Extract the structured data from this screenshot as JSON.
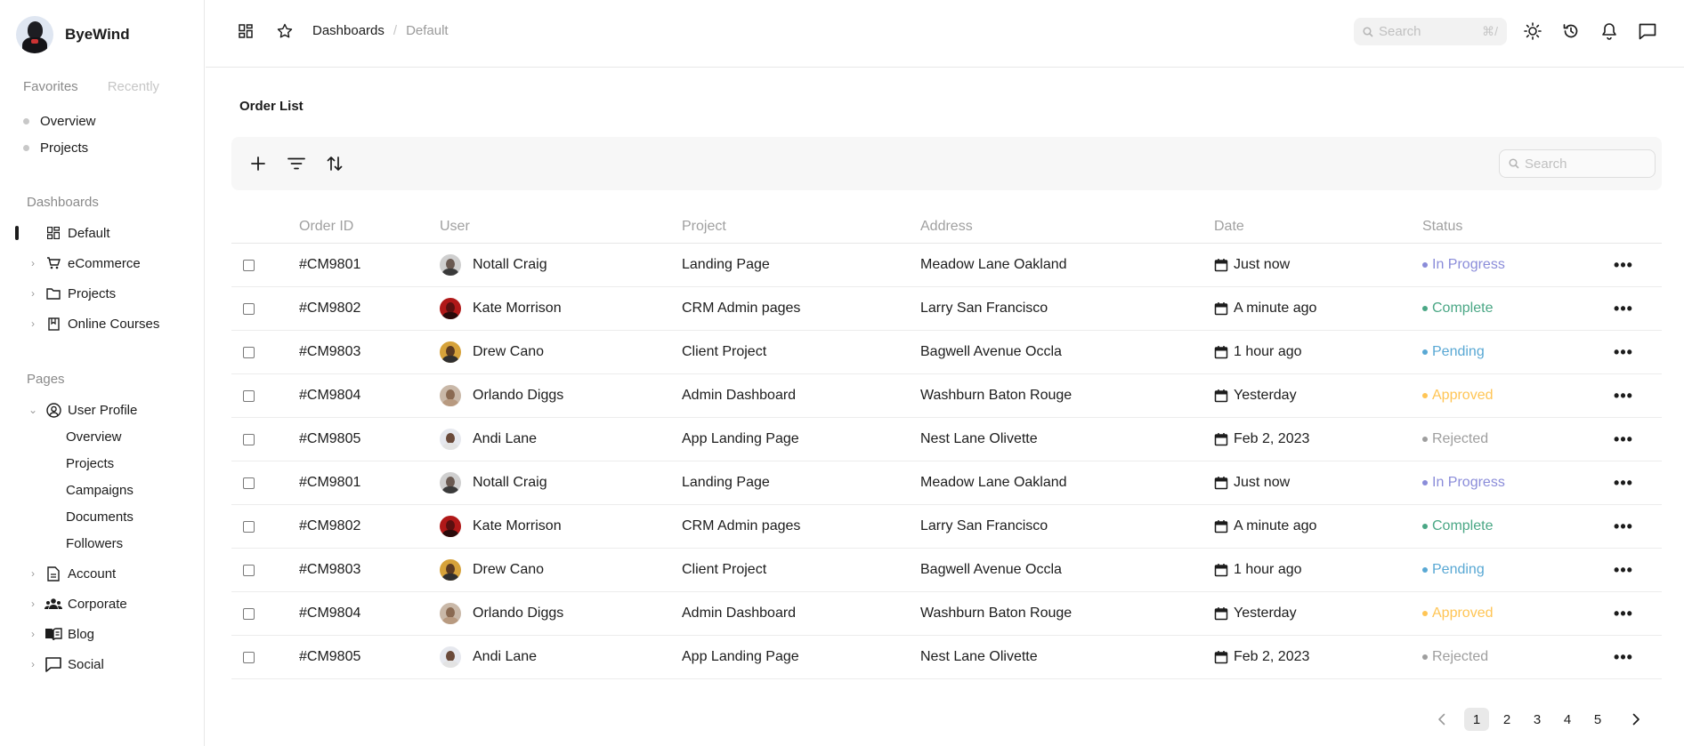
{
  "app": {
    "brand_name": "ByeWind"
  },
  "sidebar": {
    "tabs": [
      "Favorites",
      "Recently"
    ],
    "favorites": [
      "Overview",
      "Projects"
    ],
    "dashboards_title": "Dashboards",
    "dashboards": [
      {
        "label": "Default",
        "icon": "dashboard-icon",
        "active": true
      },
      {
        "label": "eCommerce",
        "icon": "cart-icon"
      },
      {
        "label": "Projects",
        "icon": "folder-icon"
      },
      {
        "label": "Online Courses",
        "icon": "book-icon"
      }
    ],
    "pages_title": "Pages",
    "user_profile": {
      "label": "User Profile",
      "icon": "user-circle-icon",
      "children": [
        "Overview",
        "Projects",
        "Campaigns",
        "Documents",
        "Followers"
      ]
    },
    "pages": [
      {
        "label": "Account",
        "icon": "document-icon"
      },
      {
        "label": "Corporate",
        "icon": "team-icon"
      },
      {
        "label": "Blog",
        "icon": "open-book-icon"
      },
      {
        "label": "Social",
        "icon": "chat-icon"
      }
    ]
  },
  "header": {
    "breadcrumb": [
      "Dashboards",
      "Default"
    ],
    "search_placeholder": "Search",
    "search_shortcut": "⌘/"
  },
  "main": {
    "title": "Order List",
    "table_search_placeholder": "Search",
    "columns": [
      "Order ID",
      "User",
      "Project",
      "Address",
      "Date",
      "Status"
    ],
    "status_colors": {
      "In Progress": "#8a8cd9",
      "Complete": "#4aa785",
      "Pending": "#59a8d4",
      "Approved": "#ffc555",
      "Rejected": "#9e9e9e"
    },
    "rows": [
      {
        "id": "#CM9801",
        "user": "Notall Craig",
        "project": "Landing Page",
        "address": "Meadow Lane Oakland",
        "date": "Just now",
        "status": "In Progress"
      },
      {
        "id": "#CM9802",
        "user": "Kate Morrison",
        "project": "CRM Admin pages",
        "address": "Larry San Francisco",
        "date": "A minute ago",
        "status": "Complete"
      },
      {
        "id": "#CM9803",
        "user": "Drew Cano",
        "project": "Client Project",
        "address": "Bagwell Avenue Occla",
        "date": "1 hour ago",
        "status": "Pending"
      },
      {
        "id": "#CM9804",
        "user": "Orlando Diggs",
        "project": "Admin Dashboard",
        "address": "Washburn Baton Rouge",
        "date": "Yesterday",
        "status": "Approved"
      },
      {
        "id": "#CM9805",
        "user": "Andi Lane",
        "project": "App Landing Page",
        "address": "Nest Lane Olivette",
        "date": "Feb 2, 2023",
        "status": "Rejected"
      },
      {
        "id": "#CM9801",
        "user": "Notall Craig",
        "project": "Landing Page",
        "address": "Meadow Lane Oakland",
        "date": "Just now",
        "status": "In Progress"
      },
      {
        "id": "#CM9802",
        "user": "Kate Morrison",
        "project": "CRM Admin pages",
        "address": "Larry San Francisco",
        "date": "A minute ago",
        "status": "Complete"
      },
      {
        "id": "#CM9803",
        "user": "Drew Cano",
        "project": "Client Project",
        "address": "Bagwell Avenue Occla",
        "date": "1 hour ago",
        "status": "Pending"
      },
      {
        "id": "#CM9804",
        "user": "Orlando Diggs",
        "project": "Admin Dashboard",
        "address": "Washburn Baton Rouge",
        "date": "Yesterday",
        "status": "Approved"
      },
      {
        "id": "#CM9805",
        "user": "Andi Lane",
        "project": "App Landing Page",
        "address": "Nest Lane Olivette",
        "date": "Feb 2, 2023",
        "status": "Rejected"
      }
    ],
    "pagination": {
      "pages": [
        "1",
        "2",
        "3",
        "4",
        "5"
      ],
      "current": "1"
    }
  }
}
